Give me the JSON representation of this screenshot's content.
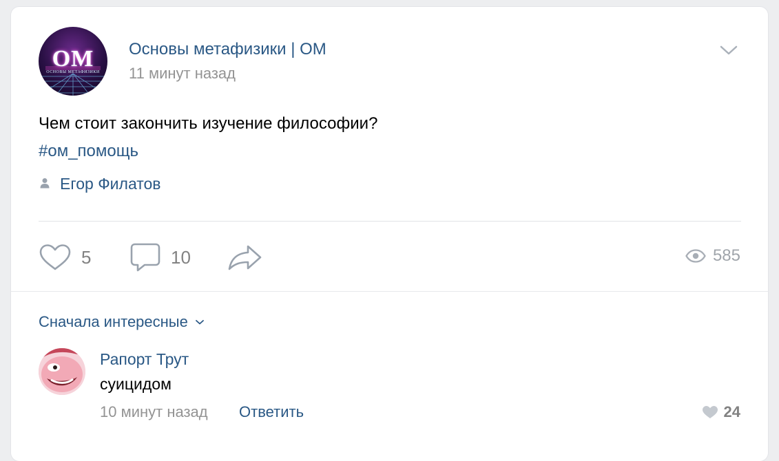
{
  "post": {
    "group_name": "Основы метафизики | ОМ",
    "time": "11 минут назад",
    "logo_text": "ОМ",
    "logo_subtext": "ОСНОВЫ МЕТАФИЗИКИ",
    "text": "Чем стоит закончить изучение философии?",
    "hashtag": "#ом_помощь",
    "author": "Егор Филатов"
  },
  "actions": {
    "likes": "5",
    "comments": "10",
    "views": "585"
  },
  "comments_section": {
    "sort_label": "Сначала интересные",
    "items": [
      {
        "author": "Рапорт Трут",
        "text": "суицидом",
        "time": "10 минут назад",
        "reply_label": "Ответить",
        "likes": "24"
      }
    ]
  },
  "icons": {
    "more": "chevron-down-icon",
    "author": "user-icon",
    "like": "heart-icon",
    "comment": "comment-icon",
    "share": "share-icon",
    "views": "eye-icon"
  },
  "colors": {
    "link": "#2a5885",
    "muted": "#939393",
    "icon": "#99a2ad",
    "background": "#edeef0"
  }
}
